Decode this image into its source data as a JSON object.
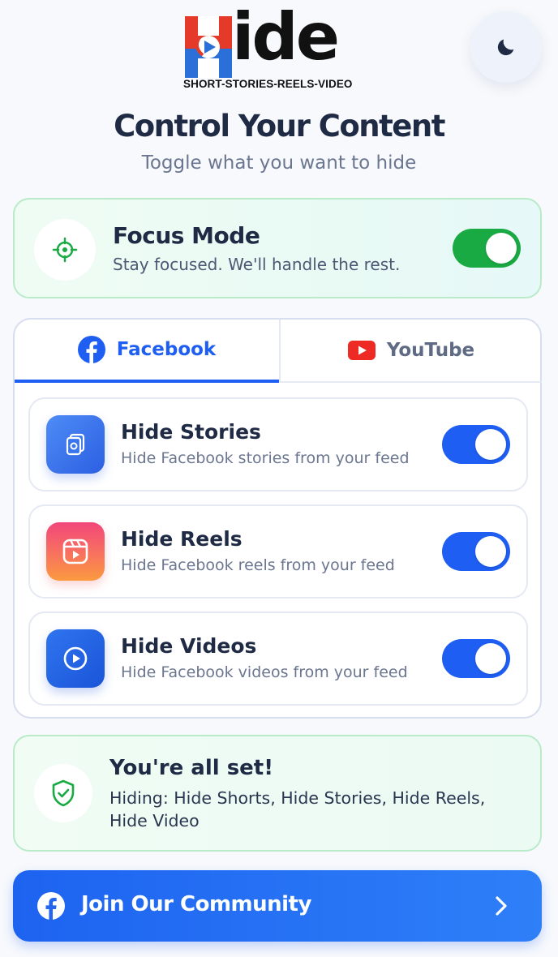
{
  "logo": {
    "letter": "H",
    "text": "ide",
    "tagline": "SHORT-STORIES-REELS-VIDEO"
  },
  "theme_toggle": {
    "icon": "moon-icon"
  },
  "header": {
    "title": "Control Your Content",
    "subtitle": "Toggle what you want to hide"
  },
  "focus_mode": {
    "icon": "target-icon",
    "title": "Focus Mode",
    "description": "Stay focused. We'll handle the rest.",
    "enabled": true
  },
  "tabs": [
    {
      "label": "Facebook",
      "icon": "facebook-icon",
      "active": true
    },
    {
      "label": "YouTube",
      "icon": "youtube-icon",
      "active": false
    }
  ],
  "items": [
    {
      "title": "Hide Stories",
      "description": "Hide Facebook stories from your feed",
      "icon": "stories-icon",
      "enabled": true
    },
    {
      "title": "Hide Reels",
      "description": "Hide Facebook reels from your feed",
      "icon": "reels-icon",
      "enabled": true
    },
    {
      "title": "Hide Videos",
      "description": "Hide Facebook videos from your feed",
      "icon": "video-play-icon",
      "enabled": true
    }
  ],
  "status": {
    "icon": "shield-check-icon",
    "title": "You're all set!",
    "description": "Hiding: Hide Shorts, Hide Stories, Hide Reels, Hide Video"
  },
  "community": {
    "label": "Join Our Community",
    "icon": "facebook-icon",
    "arrow_icon": "chevron-right-icon"
  },
  "colors": {
    "accent_blue": "#1e5ef2",
    "focus_green": "#1aaa44",
    "youtube_red": "#ee2a24"
  }
}
